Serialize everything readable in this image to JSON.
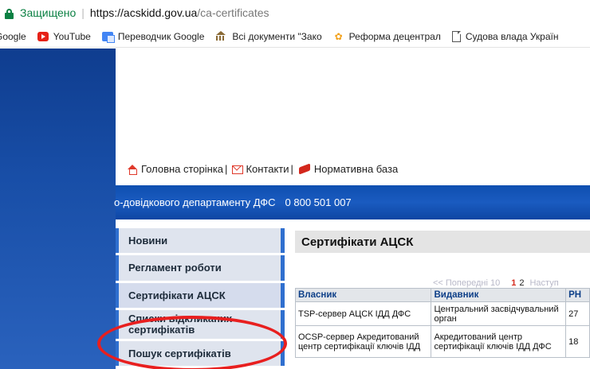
{
  "addressbar": {
    "secure_label": "Защищено",
    "url_host": "https://acskidd.gov.ua",
    "url_path": "/ca-certificates"
  },
  "bookmarks": [
    {
      "label": "Google",
      "icon": "none"
    },
    {
      "label": "YouTube",
      "icon": "youtube-icon"
    },
    {
      "label": "Переводчик Google",
      "icon": "google-translate-icon"
    },
    {
      "label": "Всі документи \"Зако",
      "icon": "zakon-icon"
    },
    {
      "label": "Реформа децентрал",
      "icon": "reform-icon"
    },
    {
      "label": "Судова влада Україн",
      "icon": "document-icon"
    }
  ],
  "toplinks": {
    "home": "Головна сторінка",
    "contacts": "Контакти",
    "normative": "Нормативна база"
  },
  "bluebar": {
    "dept": "о-довідкового департаменту ДФС",
    "phone": "0 800 501 007"
  },
  "menu": [
    "Новини",
    "Регламент роботи",
    "Сертифікати АЦСК",
    "Списки відкликаних сертифікатів",
    "Пошук сертифікатів"
  ],
  "content": {
    "title": "Сертифікати АЦСК"
  },
  "pager": {
    "prev": "<< Попередні 10",
    "current": "1",
    "page2": "2",
    "next": "Наступ"
  },
  "table": {
    "headers": [
      "Власник",
      "Видавник",
      "РН"
    ],
    "rows": [
      {
        "owner": "TSP-сервер АЦСК ІДД ДФС",
        "issuer": "Центральний засвідчувальний орган",
        "rn": "27"
      },
      {
        "owner": "OCSP-сервер Акредитований центр сертифікації ключів ІДД",
        "issuer": "Акредитований центр сертифікації ключів ІДД ДФС",
        "rn": "18"
      }
    ]
  },
  "colors": {
    "annotation_circle": "#e81f1f",
    "nav_blue": "#1a5bc0",
    "secure_green": "#0b8043"
  }
}
